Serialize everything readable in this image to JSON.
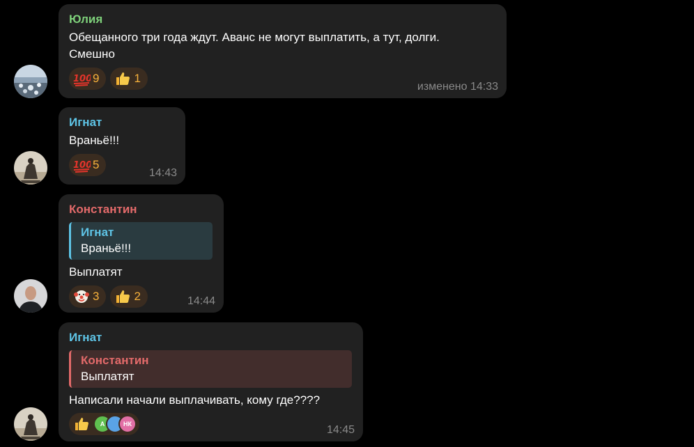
{
  "colors": {
    "background": "#000000",
    "bubble": "#212121",
    "reaction_bg": "#3a2c20",
    "reaction_count": "#f7b13b",
    "name_yulia": "#7ed07a",
    "name_ignat": "#5ec4e6",
    "name_konstantin": "#e36a6a",
    "meta": "#8a8a8a"
  },
  "messages": [
    {
      "sender": "Юлия",
      "text_lines": [
        "Обещанного три года ждут. Аванс не могут выплатить, а тут, долги.",
        "Смешно"
      ],
      "reactions": [
        {
          "icon": "hundred-points-icon",
          "count": "9"
        },
        {
          "icon": "thumbs-up-icon",
          "count": "1"
        }
      ],
      "meta": "изменено 14:33"
    },
    {
      "sender": "Игнат",
      "text": "Враньё!!!",
      "reactions": [
        {
          "icon": "hundred-points-icon",
          "count": "5"
        }
      ],
      "meta": "14:43"
    },
    {
      "sender": "Константин",
      "reply": {
        "name": "Игнат",
        "text": "Враньё!!!"
      },
      "text": "Выплатят",
      "reactions": [
        {
          "icon": "clown-face-icon",
          "count": "3"
        },
        {
          "icon": "thumbs-up-icon",
          "count": "2"
        }
      ],
      "meta": "14:44"
    },
    {
      "sender": "Игнат",
      "reply": {
        "name": "Константин",
        "text": "Выплатят"
      },
      "text": "Написали начали выплачивать, кому где????",
      "reactions": [
        {
          "icon": "thumbs-up-icon",
          "reactors": [
            "А",
            "",
            "НК"
          ]
        }
      ],
      "meta": "14:45"
    }
  ]
}
